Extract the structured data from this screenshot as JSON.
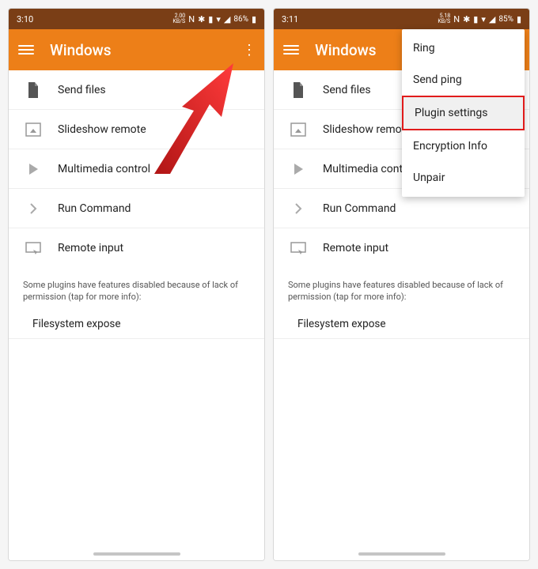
{
  "left": {
    "status": {
      "time": "3:10",
      "speed": "2.00",
      "speed_unit": "KB/S",
      "battery": "86%"
    },
    "appbar": {
      "title": "Windows"
    },
    "rows": [
      {
        "label": "Send files"
      },
      {
        "label": "Slideshow remote"
      },
      {
        "label": "Multimedia control"
      },
      {
        "label": "Run Command"
      },
      {
        "label": "Remote input"
      }
    ],
    "info": "Some plugins have features disabled because of lack of permission (tap for more info):",
    "disabled": [
      "Filesystem expose"
    ]
  },
  "right": {
    "status": {
      "time": "3:11",
      "speed": "5.18",
      "speed_unit": "KB/S",
      "battery": "85%"
    },
    "appbar": {
      "title": "Windows"
    },
    "rows": [
      {
        "label": "Send files"
      },
      {
        "label": "Slideshow remote"
      },
      {
        "label": "Multimedia control"
      },
      {
        "label": "Run Command"
      },
      {
        "label": "Remote input"
      }
    ],
    "info": "Some plugins have features disabled because of lack of permission (tap for more info):",
    "disabled": [
      "Filesystem expose"
    ],
    "menu": [
      {
        "label": "Ring"
      },
      {
        "label": "Send ping"
      },
      {
        "label": "Plugin settings",
        "highlight": true
      },
      {
        "label": "Encryption Info"
      },
      {
        "label": "Unpair"
      }
    ]
  }
}
